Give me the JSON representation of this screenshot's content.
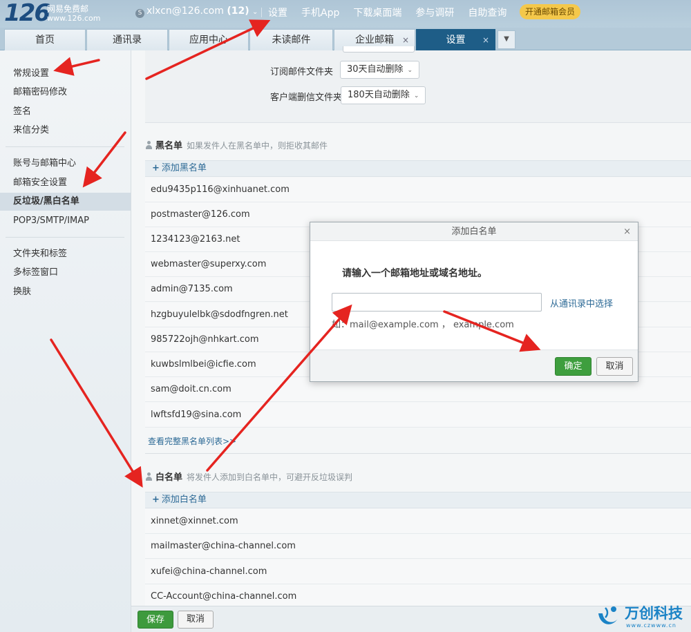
{
  "brand": {
    "logo_number": "126",
    "logo_tagline": "网易免费邮",
    "logo_domain": "www.126.com"
  },
  "header": {
    "account": "xlxcn@126.com",
    "unread_count": "(12)",
    "links": [
      "设置",
      "手机App",
      "下载桌面端",
      "参与调研",
      "自助查询"
    ],
    "vip_button": "开通邮箱会员"
  },
  "tabs": [
    {
      "label": "首页"
    },
    {
      "label": "通讯录"
    },
    {
      "label": "应用中心"
    },
    {
      "label": "未读邮件"
    },
    {
      "label": "企业邮箱"
    },
    {
      "label": "设置",
      "active": true
    }
  ],
  "sidebar": {
    "group1": [
      "常规设置",
      "邮箱密码修改",
      "签名",
      "来信分类"
    ],
    "group2": [
      "账号与邮箱中心",
      "邮箱安全设置",
      "反垃圾/黑白名单",
      "POP3/SMTP/IMAP"
    ],
    "group3": [
      "文件夹和标签",
      "多标签窗口",
      "换肤"
    ],
    "active": "反垃圾/黑白名单"
  },
  "folder_options": [
    {
      "label": "订阅邮件文件夹",
      "value": "30天自动删除"
    },
    {
      "label": "客户端删信文件夹",
      "value": "180天自动删除"
    }
  ],
  "blacklist": {
    "title": "黑名单",
    "desc": "如果发件人在黑名单中，则拒收其邮件",
    "add_label": "添加黑名单",
    "entries": [
      "edu9435p116@xinhuanet.com",
      "postmaster@126.com",
      "1234123@2163.net",
      "webmaster@superxy.com",
      "admin@7135.com",
      "hzgbuyulelbk@sdodfngren.net",
      "985722ojh@nhkart.com",
      "kuwbslmlbei@icfie.com",
      "sam@doit.cn.com",
      "lwftsfd19@sina.com"
    ],
    "more_link": "查看完整黑名单列表>>"
  },
  "whitelist": {
    "title": "白名单",
    "desc": "将发件人添加到白名单中，可避开反垃圾误判",
    "add_label": "添加白名单",
    "entries": [
      "xinnet@xinnet.com",
      "mailmaster@china-channel.com",
      "xufei@china-channel.com",
      "CC-Account@china-channel.com"
    ]
  },
  "bottom_actions": {
    "save": "保存",
    "cancel": "取消"
  },
  "dialog": {
    "title": "添加白名单",
    "prompt": "请输入一个邮箱地址或域名地址。",
    "input_value": "",
    "contacts_link": "从通讯录中选择",
    "example": "如：mail@example.com ， example.com",
    "ok": "确定",
    "cancel": "取消"
  },
  "watermark": {
    "name": "万创科技",
    "url": "www.czwww.cn"
  },
  "colors": {
    "accent": "#1e5d87",
    "primary_button": "#3e9e3e",
    "link": "#2d6a96",
    "annotation_arrow": "#e52420"
  }
}
